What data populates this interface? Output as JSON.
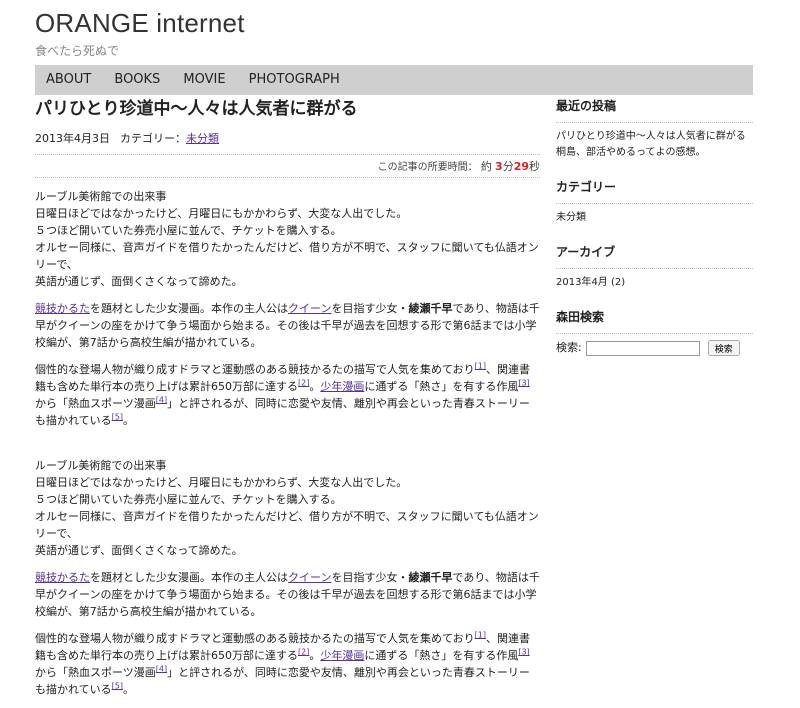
{
  "site": {
    "title": "ORANGE internet",
    "tagline": "食べたら死ぬで"
  },
  "nav": {
    "items": [
      "ABOUT",
      "BOOKS",
      "MOVIE",
      "PHOTOGRAPH"
    ]
  },
  "post": {
    "title": "パリひとり珍道中〜人々は人気者に群がる",
    "date": "2013年4月3日",
    "category_label": "カテゴリー：",
    "category_link": "未分類",
    "readtime_label": "この記事の所要時間：",
    "readtime_approx": "約",
    "readtime_min_num": "3",
    "readtime_min_unit": "分",
    "readtime_sec_num": "29",
    "readtime_sec_unit": "秒",
    "intro_lines": [
      "ルーブル美術館での出来事",
      "日曜日ほどではなかったけど、月曜日にもかかわらず、大変な人出でした。",
      "５つほど開いていた券売小屋に並んで、チケットを購入する。",
      "オルセー同様に、音声ガイドを借りたかったんだけど、借り方が不明で、スタッフに聞いても仏語オンリーで、",
      "英語が通じず、面倒くさくなって諦めた。"
    ],
    "p2": {
      "link1": "競技かるた",
      "t1": "を題材とした少女漫画。本作の主人公は",
      "link2": "クイーン",
      "t2": "を目指す少女・",
      "bold": "綾瀬千早",
      "t3": "であり、物語は千早がクイーンの座をかけて争う場面から始まる。その後は千早が過去を回想する形で第6話までは小学校編が、第7話から高校生編が描かれている。"
    },
    "p3": {
      "t1": "個性的な登場人物が織り成すドラマと運動感のある競技かるたの描写で人気を集めており",
      "ref1": "[1]",
      "t2": "、関連書籍も含めた単行本の売り上げは累計650万部に達する",
      "ref2": "[2]",
      "t3": "。",
      "link1": "少年漫画",
      "t4": "に通ずる「熱さ」を有する作風",
      "ref3": "[3]",
      "t5": "から「熱血スポーツ漫画",
      "ref4": "[4]",
      "t6": "」と評されるが、同時に恋愛や友情、離別や再会といった青春ストーリーも描かれている",
      "ref5": "[5]",
      "t7": "。"
    }
  },
  "sidebar": {
    "recent_title": "最近の投稿",
    "recent_items": [
      "パリひとり珍道中〜人々は人気者に群がる",
      "桐島、部活やめるってよの感想。"
    ],
    "category_title": "カテゴリー",
    "category_items": [
      "未分類"
    ],
    "archive_title": "アーカイブ",
    "archive_items": [
      "2013年4月 (2)"
    ],
    "search_title": "森田検索",
    "search_label": "検索:",
    "search_value": "",
    "search_button": "検索"
  }
}
